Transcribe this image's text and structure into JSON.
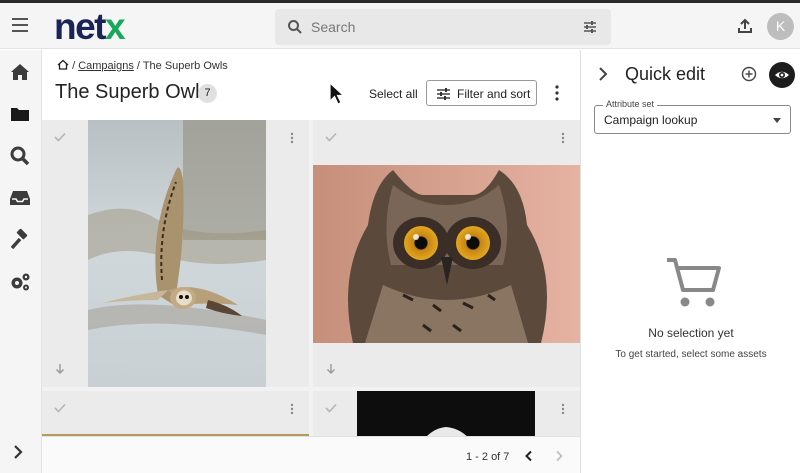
{
  "app": {
    "logo_main": "net",
    "logo_accent": "x",
    "brand_color": "#1b2456",
    "accent_color": "#18a85a"
  },
  "header": {
    "search_placeholder": "Search",
    "avatar_initial": "K"
  },
  "nav": {
    "items": [
      "home-icon",
      "folder-icon",
      "search-icon",
      "inbox-icon",
      "hammer-icon",
      "gears-icon"
    ]
  },
  "breadcrumb": {
    "sep": "/",
    "campaigns": "Campaigns",
    "current": "The Superb Owls"
  },
  "page": {
    "title": "The Superb Owls",
    "count": "7",
    "select_all": "Select all",
    "filter_sort": "Filter and sort"
  },
  "grid": {
    "assets": [
      "short-eared-owl-flying",
      "eagle-owl-portrait",
      "partial-asset-3",
      "partial-asset-4"
    ]
  },
  "pager": {
    "range": "1 - 2 of 7"
  },
  "quick_edit": {
    "title": "Quick edit",
    "attr_label": "Attribute set",
    "attr_value": "Campaign lookup",
    "empty_title": "No selection yet",
    "empty_sub": "To get started, select some assets"
  }
}
